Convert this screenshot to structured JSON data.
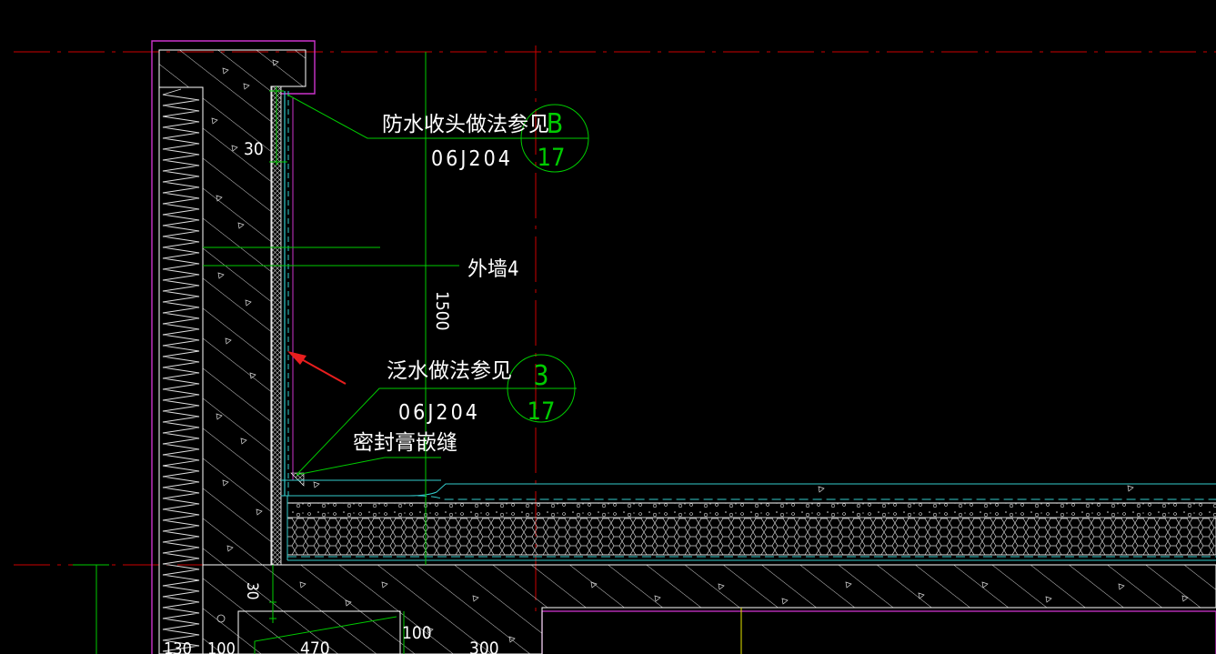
{
  "drawing": {
    "background": "#000000",
    "colors": {
      "axis_line": "#cc0000",
      "dimension": "#00cc00",
      "text": "#ffffff",
      "concrete_hatch": "#ffffff",
      "waterproof_layer": "#33cccc",
      "wall_outline": "#cc33cc",
      "arrow": "#e81e1e",
      "column_edge": "#e6e600"
    },
    "callouts": {
      "flashing_note": "防水收头做法参见",
      "flashing_ref": "06J204",
      "flashing_detail_no": "B",
      "flashing_sheet_no": "17",
      "exterior_wall": "外墙4",
      "upstand_note": "泛水做法参见",
      "upstand_ref": "06J204",
      "upstand_detail_no": "3",
      "upstand_sheet_no": "17",
      "sealant_note": "密封膏嵌缝"
    },
    "dimensions": {
      "gap_top": "30",
      "parapet_height": "1500",
      "gap_bottom": "30",
      "width_100_right": "100",
      "width_130": "130",
      "width_100_left": "100",
      "width_470": "470",
      "width_300": "300"
    }
  }
}
